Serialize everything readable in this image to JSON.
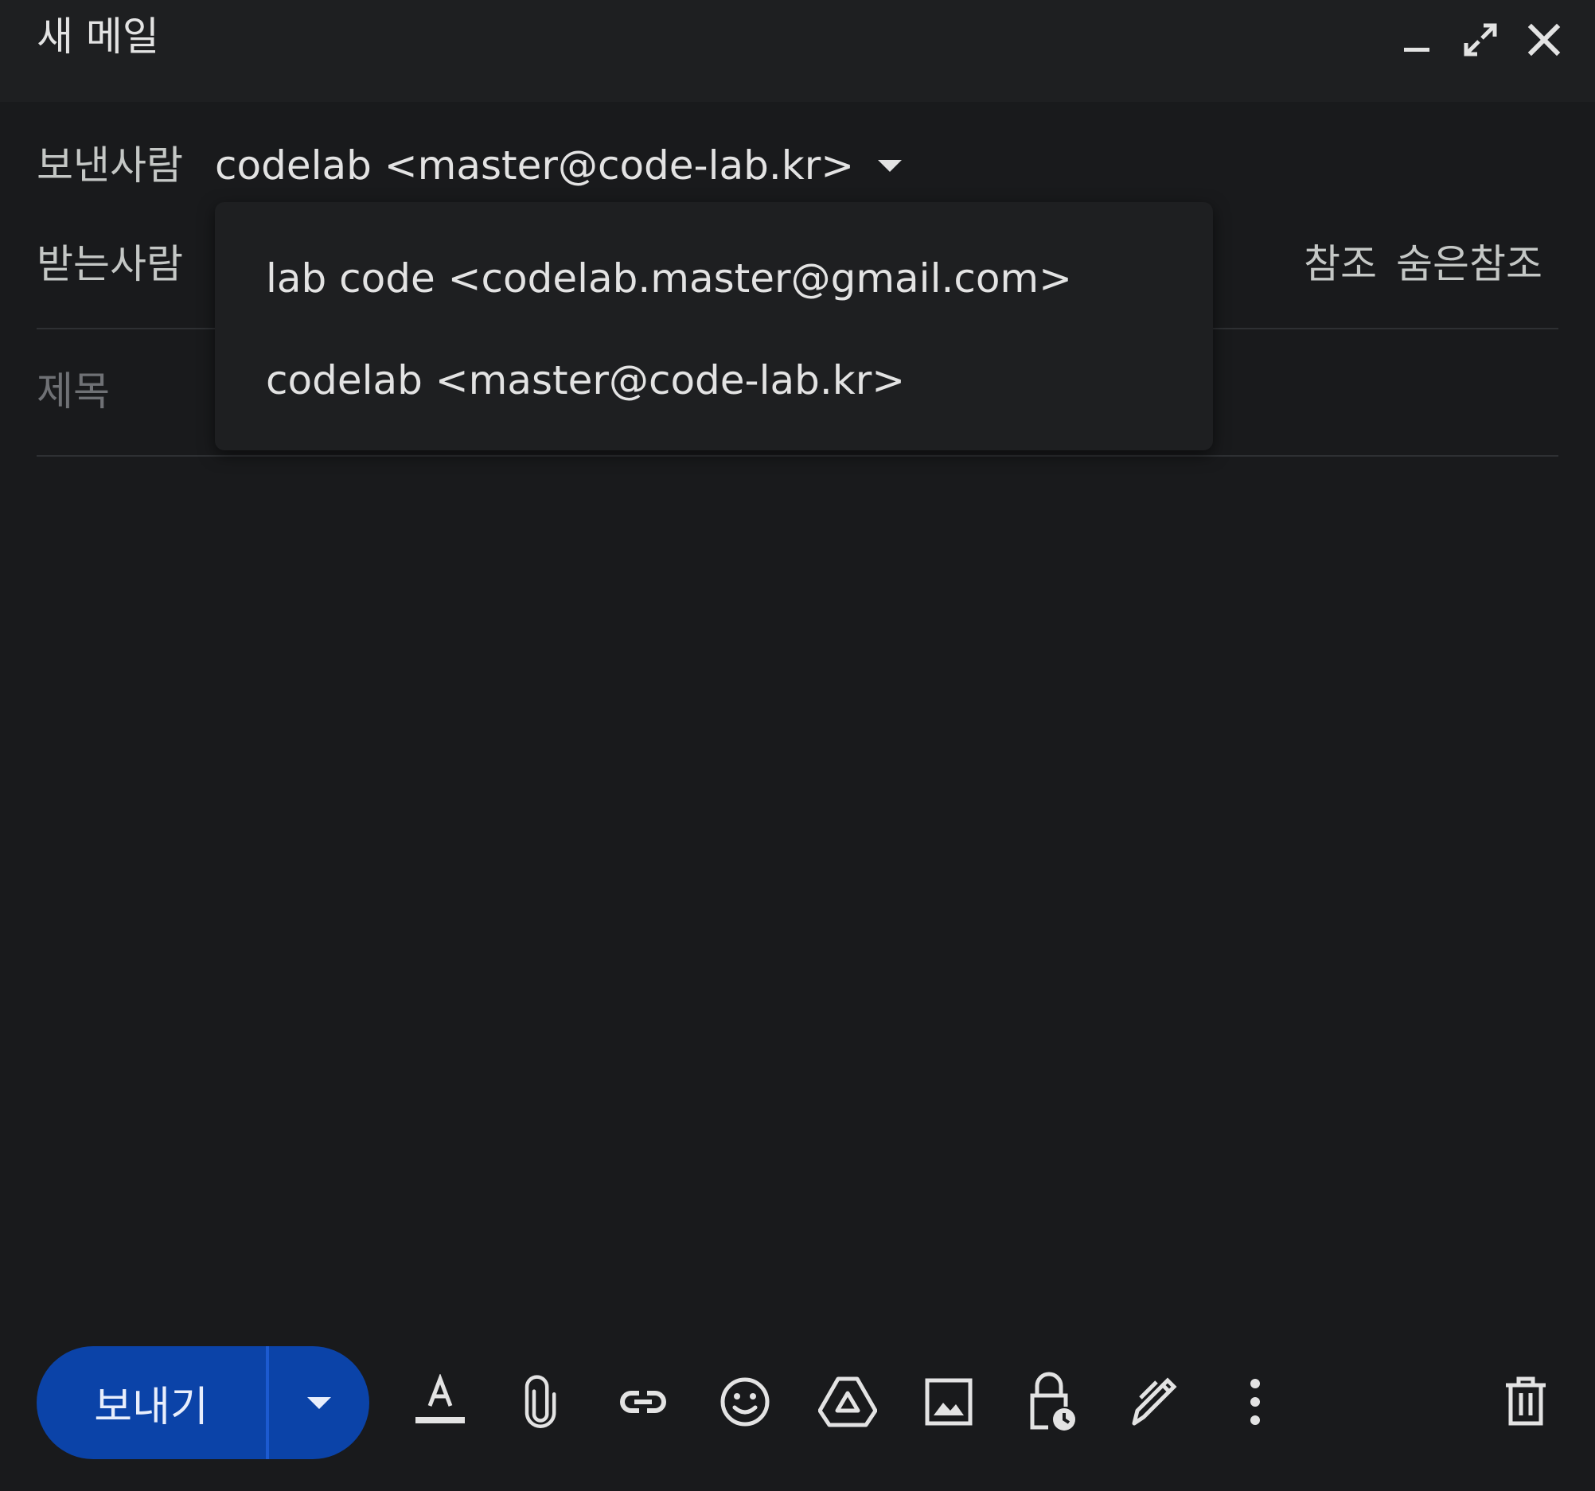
{
  "window": {
    "title": "새 메일"
  },
  "from": {
    "label": "보낸사람",
    "value": "codelab <master@code-lab.kr>"
  },
  "to": {
    "label": "받는사람",
    "cc_label": "참조",
    "bcc_label": "숨은참조"
  },
  "subject": {
    "placeholder": "제목"
  },
  "from_dropdown": {
    "options": [
      "lab code <codelab.master@gmail.com>",
      "codelab <master@code-lab.kr>"
    ]
  },
  "toolbar": {
    "send_label": "보내기",
    "tools": [
      "format-text-icon",
      "attach-file-icon",
      "insert-link-icon",
      "insert-emoji-icon",
      "google-drive-icon",
      "insert-photo-icon",
      "confidential-mode-icon",
      "signature-icon",
      "more-options-icon",
      "discard-draft-icon"
    ]
  },
  "colors": {
    "background": "#191a1c",
    "titlebar": "#1e1f21",
    "send_button": "#0b43a8",
    "text": "#e3e3e3",
    "muted_text": "#6f7175"
  }
}
